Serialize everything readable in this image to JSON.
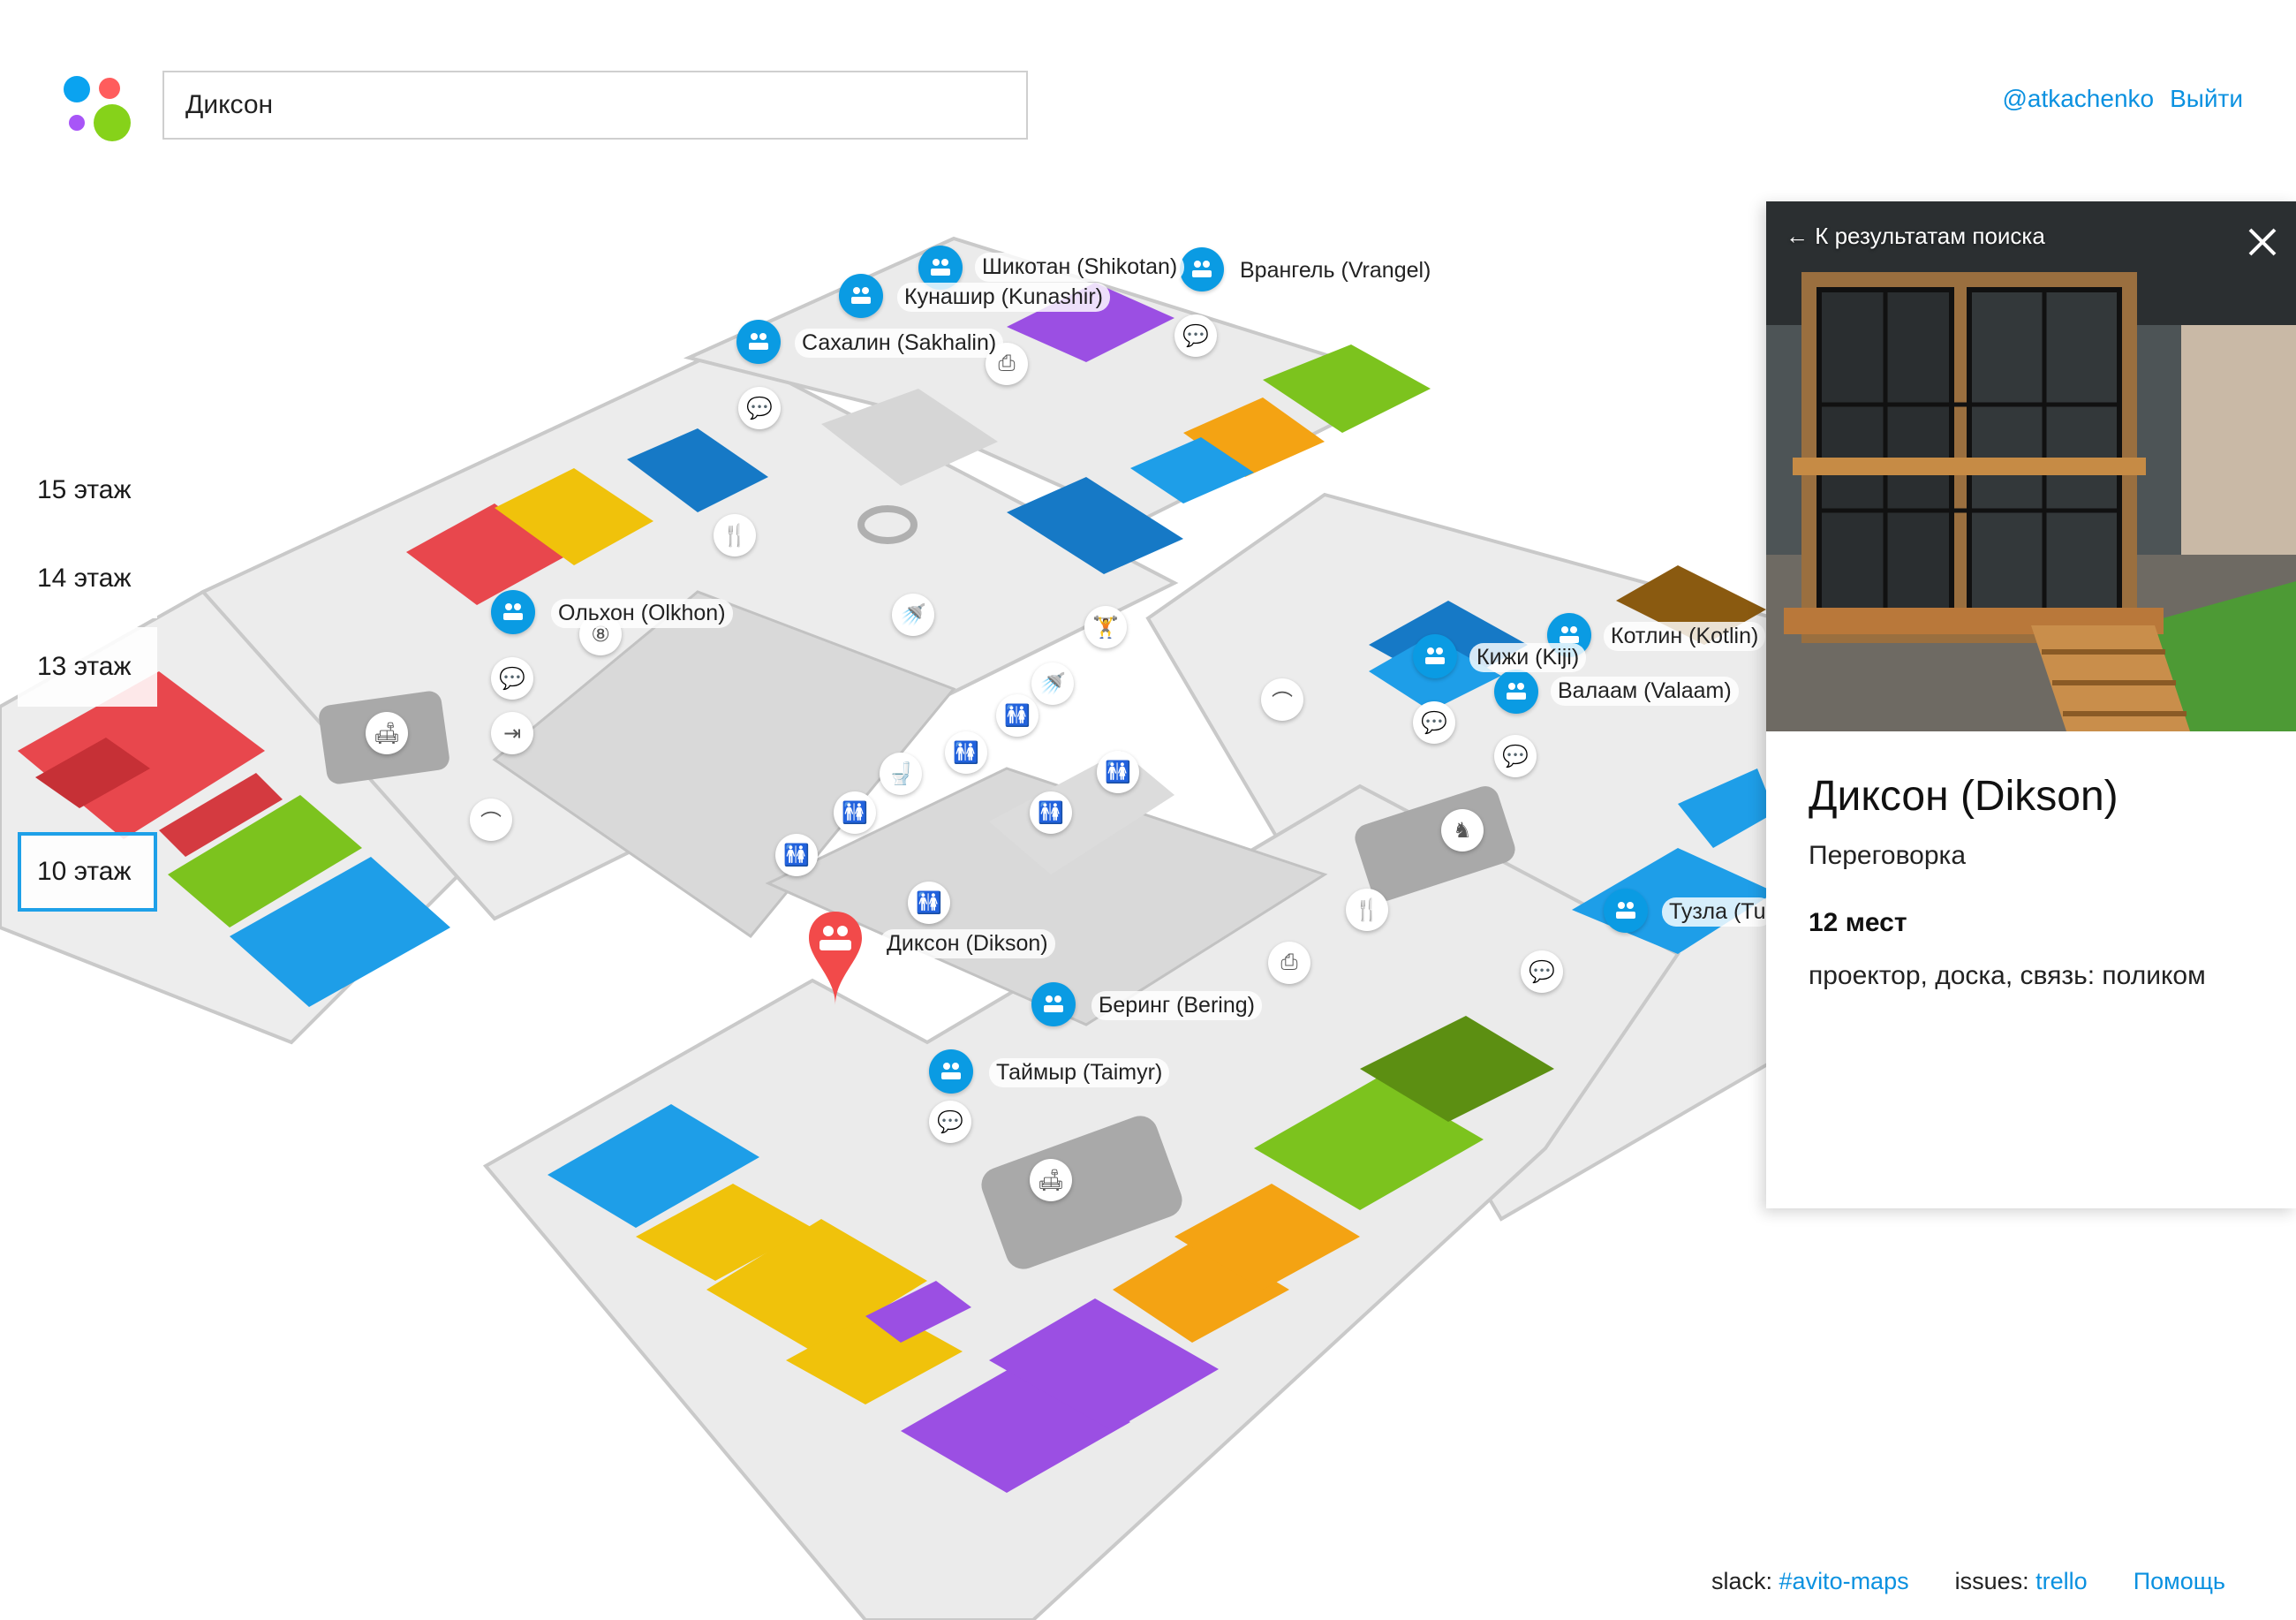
{
  "search": {
    "value": "Диксон"
  },
  "user": {
    "handle": "@atkachenko",
    "logout": "Выйти"
  },
  "floors": [
    {
      "label": "15 этаж",
      "active": false
    },
    {
      "label": "14 этаж",
      "active": false
    },
    {
      "label": "13 этаж",
      "active": false
    },
    {
      "label": "10 этаж",
      "active": true
    }
  ],
  "rooms": [
    {
      "label": "Шикотан (Shikotan)"
    },
    {
      "label": "Врангель (Vrangel)"
    },
    {
      "label": "Кунашир (Kunashir)"
    },
    {
      "label": "Сахалин (Sakhalin)"
    },
    {
      "label": "Ольхон (Olkhon)"
    },
    {
      "label": "Котлин (Kotlin)"
    },
    {
      "label": "Кижи (Kiji)"
    },
    {
      "label": "Валаам (Valaam)"
    },
    {
      "label": "Тузла (Tu"
    },
    {
      "label": "Диксон (Dikson)"
    },
    {
      "label": "Беринг (Bering)"
    },
    {
      "label": "Таймыр (Taimyr)"
    }
  ],
  "panel": {
    "back_label": "← К результатам поиска",
    "title": "Диксон (Dikson)",
    "type": "Переговорка",
    "seats": "12 мест",
    "equipment": "проектор, доска, связь: поликом"
  },
  "footer": {
    "slack_label": "slack:",
    "slack_link": "#avito-maps",
    "issues_label": "issues:",
    "issues_link": "trello",
    "help": "Помощь"
  },
  "colors": {
    "accent": "#0a9be3",
    "selected_pin": "#f24a4a",
    "desk_red": "#e8474d",
    "desk_yellow": "#f0c20b",
    "desk_blue": "#1e9ee8",
    "desk_green": "#7cc31e",
    "desk_orange": "#f4a313",
    "desk_purple": "#9b4fe3"
  }
}
